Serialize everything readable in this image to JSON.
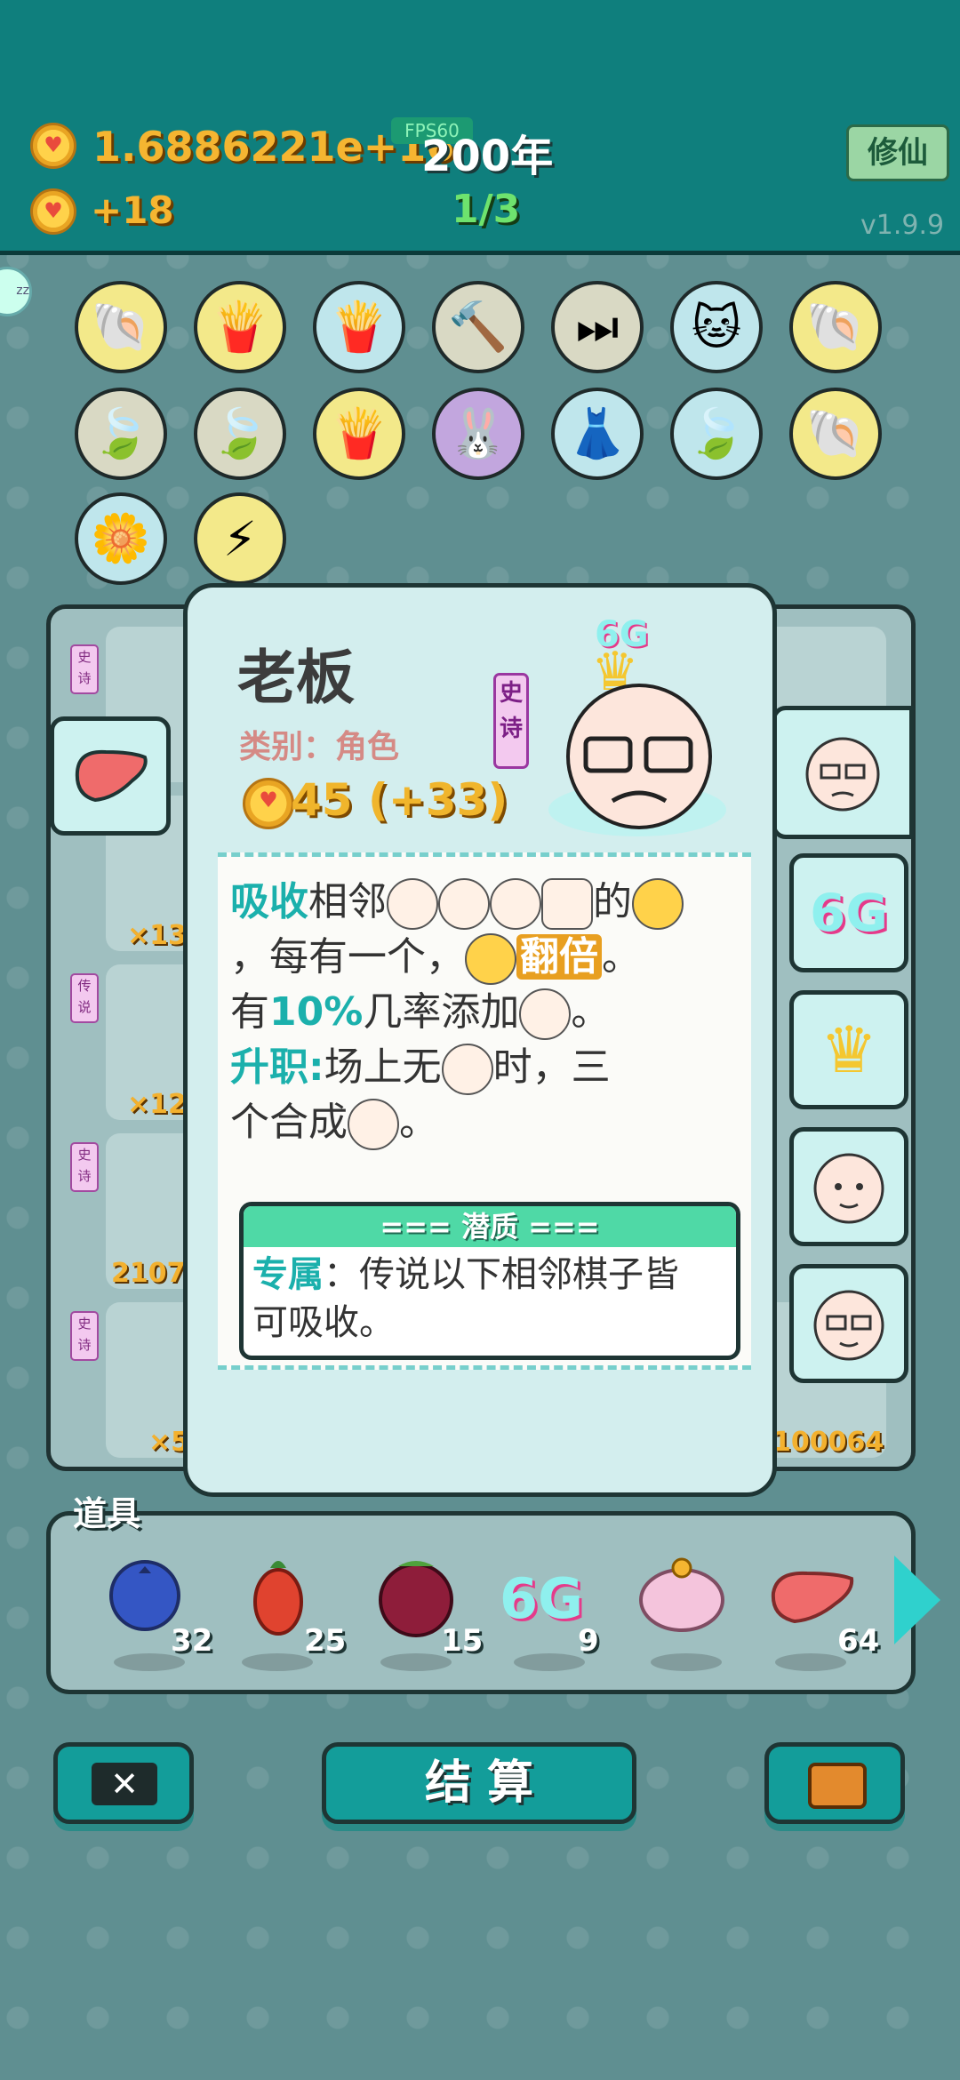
{
  "header": {
    "coins": "1.6886221e+16",
    "fps": "FPS60",
    "year": "200年",
    "income": "+18",
    "progress": "1/3",
    "xiuxian_button": "修仙",
    "version": "v1.9.9"
  },
  "board_counts": [
    "×13",
    "×12",
    "2107",
    "×5",
    "100064"
  ],
  "board_tags": [
    "史诗",
    "传说",
    "史诗",
    "史诗"
  ],
  "card": {
    "title": "老板",
    "category": "类别：角色",
    "rarity": "史诗",
    "badge": "6G",
    "price": "45 (+33)",
    "line1_a": "吸收",
    "line1_b": "相邻",
    "line1_c": "的",
    "line2_a": "，每有一个，",
    "line2_b": "翻倍",
    "line2_c": "。",
    "line3_a": "有",
    "line3_b": "10%",
    "line3_c": "几率添加",
    "line3_d": "。",
    "line4_a": "升职:",
    "line4_b": "场上无",
    "line4_c": "时，三",
    "line5_a": "个合成",
    "line5_b": "。",
    "potential_title": "=== 潜质 ===",
    "potential_a": "专属",
    "potential_b": "：传说以下相邻棋子皆",
    "potential_c": "可吸收。"
  },
  "items_label": "道具",
  "items": [
    {
      "name": "blueberry",
      "count": "32"
    },
    {
      "name": "chili",
      "count": "25"
    },
    {
      "name": "bayberry",
      "count": "15"
    },
    {
      "name": "6G",
      "count": "9"
    },
    {
      "name": "piggy-bank",
      "count": ""
    },
    {
      "name": "liver",
      "count": "64"
    }
  ],
  "buttons": {
    "settle": "结 算"
  },
  "colors": {
    "header": "#0f7f7d",
    "gold": "#f5b531",
    "card": "#d3eeee",
    "accent": "#1bb0ac"
  }
}
